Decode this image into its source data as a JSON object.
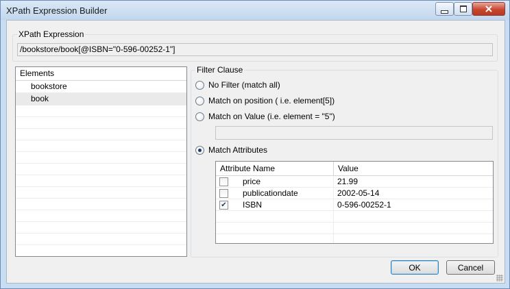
{
  "window": {
    "title": "XPath Expression Builder"
  },
  "xpath": {
    "group_label": "XPath Expression",
    "value": "/bookstore/book[@ISBN=\"0-596-00252-1\"]"
  },
  "elements": {
    "header": "Elements",
    "items": [
      {
        "label": "bookstore",
        "selected": false
      },
      {
        "label": "book",
        "selected": true
      }
    ]
  },
  "filter": {
    "group_label": "Filter Clause",
    "options": [
      {
        "label": "No Filter (match all)",
        "checked": false
      },
      {
        "label": "Match on position ( i.e. element[5])",
        "checked": false
      },
      {
        "label": "Match on Value (i.e. element = \"5\")",
        "checked": false
      },
      {
        "label": "Match Attributes",
        "checked": true
      }
    ],
    "value_input": ""
  },
  "attributes": {
    "headers": {
      "name": "Attribute Name",
      "value": "Value"
    },
    "rows": [
      {
        "name": "price",
        "value": "21.99",
        "checked": false
      },
      {
        "name": "publicationdate",
        "value": "2002-05-14",
        "checked": false
      },
      {
        "name": "ISBN",
        "value": "0-596-00252-1",
        "checked": true
      }
    ]
  },
  "buttons": {
    "ok": "OK",
    "cancel": "Cancel"
  },
  "colors": {
    "titlebar": "#c9ddf2",
    "close_button": "#c9462f",
    "selection": "#eaeaea"
  }
}
